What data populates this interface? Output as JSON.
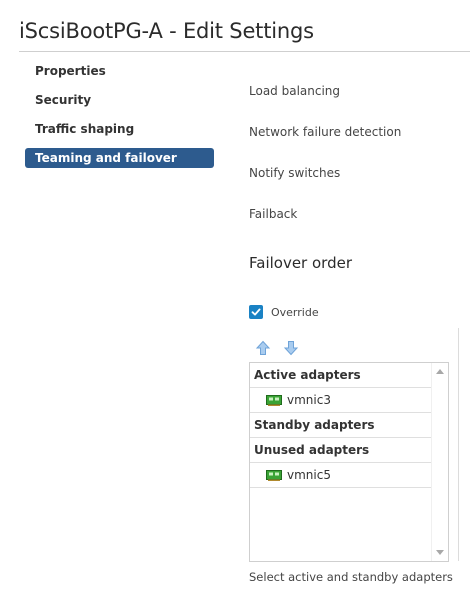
{
  "dialog": {
    "title": "iScsiBootPG-A - Edit Settings"
  },
  "nav": {
    "items": [
      {
        "label": "Properties",
        "active": false
      },
      {
        "label": "Security",
        "active": false
      },
      {
        "label": "Traffic shaping",
        "active": false
      },
      {
        "label": "Teaming and failover",
        "active": true
      }
    ]
  },
  "settings": {
    "load_balancing_label": "Load balancing",
    "network_failure_detection_label": "Network failure detection",
    "notify_switches_label": "Notify switches",
    "failback_label": "Failback"
  },
  "failover": {
    "heading": "Failover order",
    "override_label": "Override",
    "override_checked": true,
    "groups": {
      "active_label": "Active adapters",
      "standby_label": "Standby adapters",
      "unused_label": "Unused adapters"
    },
    "active_adapters": [
      "vmnic3"
    ],
    "standby_adapters": [],
    "unused_adapters": [
      "vmnic5"
    ],
    "hint": "Select active and standby adapters"
  },
  "icons": {
    "move_up": "arrow-up-icon",
    "move_down": "arrow-down-icon",
    "nic": "network-adapter-icon",
    "checkbox": "checkmark-icon"
  },
  "colors": {
    "nav_active_bg": "#2d5b8e",
    "checkbox": "#1a82c4",
    "arrow": "#7fb2e3",
    "nic_icon": "#3aa335"
  }
}
